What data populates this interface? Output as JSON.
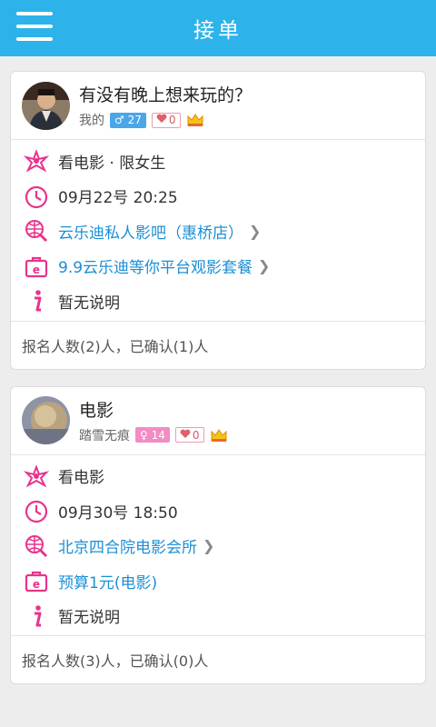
{
  "appbar": {
    "title": "接单",
    "menu_icon": "menu-icon"
  },
  "colors": {
    "primary": "#2db3ea",
    "link": "#1a8fd6",
    "icon_pink": "#e8338c",
    "male_badge": "#4aa6e8",
    "female_badge": "#f38bc4"
  },
  "posts": [
    {
      "title": "有没有晚上想来玩的？",
      "user": "我的",
      "gender_symbol": "♂",
      "gender_count": "27",
      "heart_count": "0",
      "activity": "看电影 · 限女生",
      "time": "09月22号  20:25",
      "place": "云乐迪私人影吧（惠桥店）",
      "budget": "9.9云乐迪等你平台观影套餐",
      "note": "暂无说明",
      "footer": "报名人数(2)人，已确认(1)人"
    },
    {
      "title": "电影",
      "user": "踏雪无痕",
      "gender_symbol": "♀",
      "gender_count": "14",
      "heart_count": "0",
      "activity": "看电影",
      "time": "09月30号  18:50",
      "place": "北京四合院电影会所",
      "budget": "预算1元(电影)",
      "note": "暂无说明",
      "footer": "报名人数(3)人，已确认(0)人"
    }
  ]
}
